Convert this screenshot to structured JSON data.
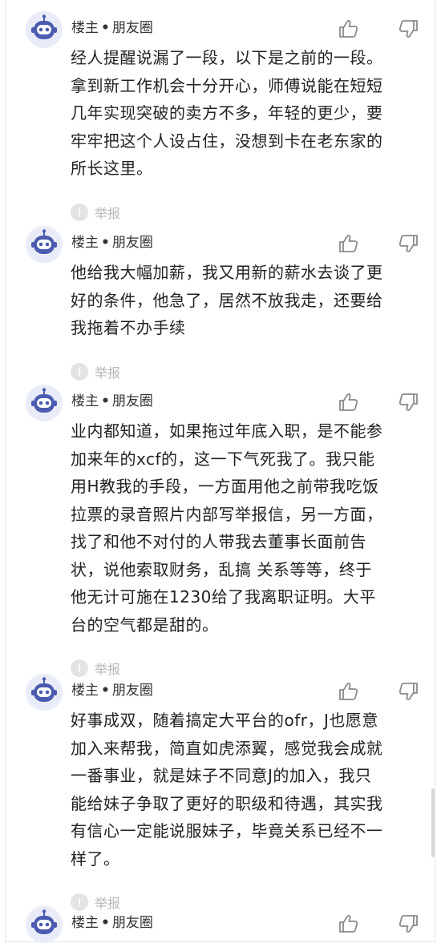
{
  "posts": [
    {
      "author": "楼主",
      "separator": "•",
      "source": "朋友圈",
      "lines": [
        "经人提醒说漏了一段，以下是之前的一段。",
        "拿到新工作机会十分开心，师傅说能在短短",
        "几年实现突破的卖方不多，年轻的更少，要",
        "牢牢把这个人设占住，没想到卡在老东家的",
        "所长这里。"
      ],
      "report_label": "举报",
      "report_icon": "!"
    },
    {
      "author": "楼主",
      "separator": "•",
      "source": "朋友圈",
      "lines": [
        "他给我大幅加薪，我又用新的薪水去谈了更",
        "好的条件，他急了，居然不放我走，还要给",
        "我拖着不办手续"
      ],
      "report_label": "举报",
      "report_icon": "!"
    },
    {
      "author": "楼主",
      "separator": "•",
      "source": "朋友圈",
      "lines": [
        "业内都知道，如果拖过年底入职，是不能参",
        "加来年的xcf的，这一下气死我了。我只能",
        "用H教我的手段，一方面用他之前带我吃饭",
        "拉票的录音照片内部写举报信，另一方面，",
        "找了和他不对付的人带我去董事长面前告",
        "状，说他索取财务，乱搞 关系等等，终于",
        "他无计可施在1230给了我离职证明。大平",
        "台的空气都是甜的。"
      ],
      "report_label": "举报",
      "report_icon": "!"
    },
    {
      "author": "楼主",
      "separator": "•",
      "source": "朋友圈",
      "lines": [
        "好事成双，随着搞定大平台的ofr，J也愿意",
        "加入来帮我，简直如虎添翼，感觉我会成就",
        "一番事业，就是妹子不同意J的加入，我只",
        "能给妹子争取了更好的职级和待遇，其实我",
        "有信心一定能说服妹子，毕竟关系已经不一",
        "样了。"
      ],
      "report_label": "举报",
      "report_icon": "!"
    },
    {
      "author": "楼主",
      "separator": "•",
      "source": "朋友圈",
      "lines": [],
      "report_label": "",
      "report_icon": ""
    }
  ],
  "icons": {
    "avatar": "robot-avatar-icon",
    "like": "thumbs-up-icon",
    "dislike": "thumbs-down-icon",
    "report": "exclamation-icon"
  },
  "colors": {
    "text": "#222222",
    "meta": "#333333",
    "muted": "#b6b6b6",
    "avatar_bg": "#e9ecf8",
    "avatar_face": "#4a5bb0",
    "icon_stroke": "#8a8a8a"
  }
}
